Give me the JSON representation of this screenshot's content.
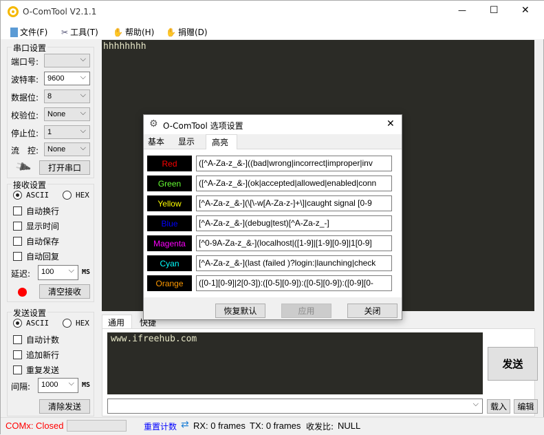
{
  "window": {
    "title": "O-ComTool V2.1.1",
    "minimize": "—",
    "maximize": "☐",
    "close": "✕"
  },
  "menu": [
    {
      "label": "文件(F)",
      "icon": "file-icon"
    },
    {
      "label": "工具(T)",
      "icon": "tools-icon"
    },
    {
      "label": "帮助(H)",
      "icon": "help-icon"
    },
    {
      "label": "捐赠(D)",
      "icon": "donate-icon"
    }
  ],
  "serial": {
    "title": "串口设置",
    "port_label": "端口号:",
    "port_value": "",
    "baud_label": "波特率:",
    "baud_value": "9600",
    "data_label": "数据位:",
    "data_value": "8",
    "parity_label": "校验位:",
    "parity_value": "None",
    "stop_label": "停止位:",
    "stop_value": "1",
    "flow_label": "流　控:",
    "flow_value": "None",
    "open_button": "打开串口"
  },
  "receive": {
    "title": "接收设置",
    "ascii": "ASCII",
    "hex": "HEX",
    "mode": "ASCII",
    "auto_wrap": "自动换行",
    "show_time": "显示时间",
    "auto_save": "自动保存",
    "auto_reply": "自动回复",
    "delay_label": "延迟:",
    "delay_value": "100",
    "delay_unit": "MS",
    "clear_button": "清空接收",
    "indicator_color": "#ff0000"
  },
  "send": {
    "title": "发送设置",
    "ascii": "ASCII",
    "hex": "HEX",
    "mode": "ASCII",
    "auto_count": "自动计数",
    "append_newline": "追加新行",
    "repeat_send": "重复发送",
    "interval_label": "间隔:",
    "interval_value": "1000",
    "interval_unit": "MS",
    "clear_button": "清除发送"
  },
  "terminal": {
    "text": "hhhhhhhh",
    "background": "#2b2b26"
  },
  "send_area": {
    "tabs": [
      "通用",
      "快捷"
    ],
    "text": "www.ifreehub.com",
    "send_button": "发送",
    "history_value": "",
    "load_button": "载入",
    "edit_button": "编辑"
  },
  "status": {
    "port_status": "COMx: Closed",
    "reset_count": "重置计数",
    "rx": "RX: 0 frames",
    "tx": "TX: 0 frames",
    "ratio_label": "收发比:",
    "ratio_value": "NULL"
  },
  "dialog": {
    "title": "O-ComTool 选项设置",
    "tabs": [
      "基本",
      "显示",
      "高亮"
    ],
    "selected_tab": "高亮",
    "rules": [
      {
        "name": "Red",
        "color": "#ff0000",
        "pattern": "([^A-Za-z_&-]((bad|wrong|incorrect|improper|inv"
      },
      {
        "name": "Green",
        "color": "#66ff33",
        "pattern": "([^A-Za-z_&-](ok|accepted|allowed|enabled|conn"
      },
      {
        "name": "Yellow",
        "color": "#ffff00",
        "pattern": "[^A-Za-z_&-](\\[\\-w[A-Za-z-]+\\]|caught signal [0-9"
      },
      {
        "name": "Blue",
        "color": "#0000ff",
        "pattern": "[^A-Za-z_&-](debug|test)[^A-Za-z_-]"
      },
      {
        "name": "Magenta",
        "color": "#ff00ff",
        "pattern": "[^0-9A-Za-z_&-](localhost|([1-9]|[1-9][0-9]|1[0-9]"
      },
      {
        "name": "Cyan",
        "color": "#00ffff",
        "pattern": "[^A-Za-z_&-](last (failed )?login:|launching|check"
      },
      {
        "name": "Orange",
        "color": "#ff9900",
        "pattern": "([0-1][0-9]|2[0-3]):([0-5][0-9]):([0-5][0-9]):([0-9][0-"
      }
    ],
    "restore_button": "恢复默认",
    "apply_button": "应用",
    "close_button": "关闭"
  }
}
